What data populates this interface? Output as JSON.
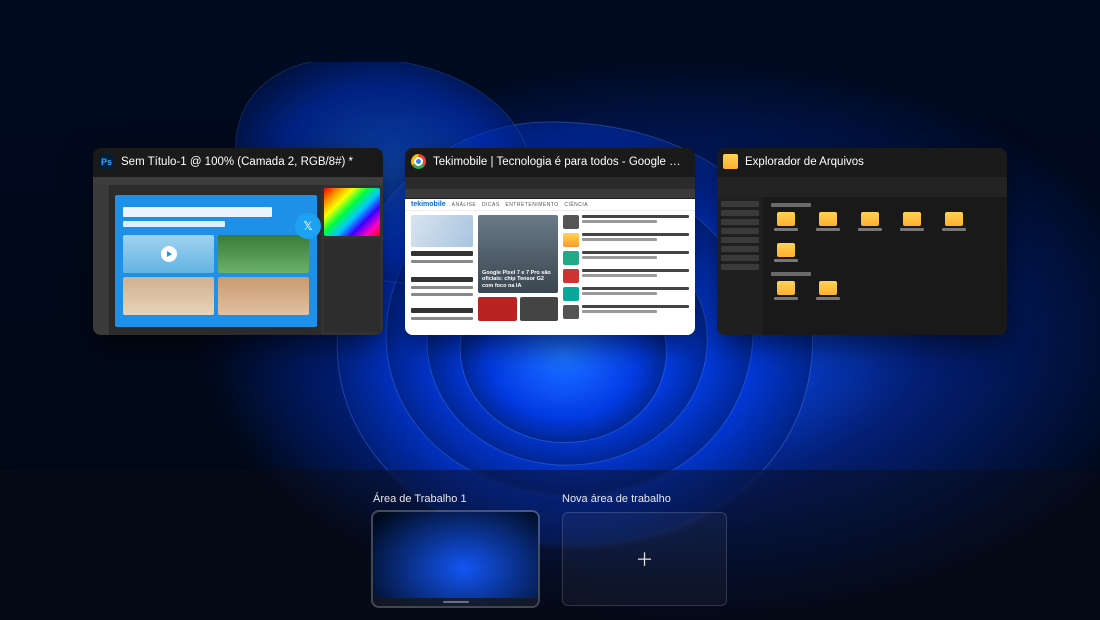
{
  "task_view": {
    "windows": [
      {
        "app": "photoshop",
        "title": "Sem Título-1 @ 100% (Camada 2, RGB/8#) *",
        "canvas_headline": "",
        "canvas_link": ""
      },
      {
        "app": "chrome",
        "title": "Tekimobile | Tecnologia é para todos - Google Chrome",
        "site_logo": "tekimobile",
        "hero_caption": "Google Pixel 7 e 7 Pro são oficiais: chip Tensor G2 com foco na IA"
      },
      {
        "app": "explorer",
        "title": "Explorador de Arquivos"
      }
    ]
  },
  "desktops": {
    "current_label": "Área de Trabalho 1",
    "new_label": "Nova área de trabalho"
  }
}
